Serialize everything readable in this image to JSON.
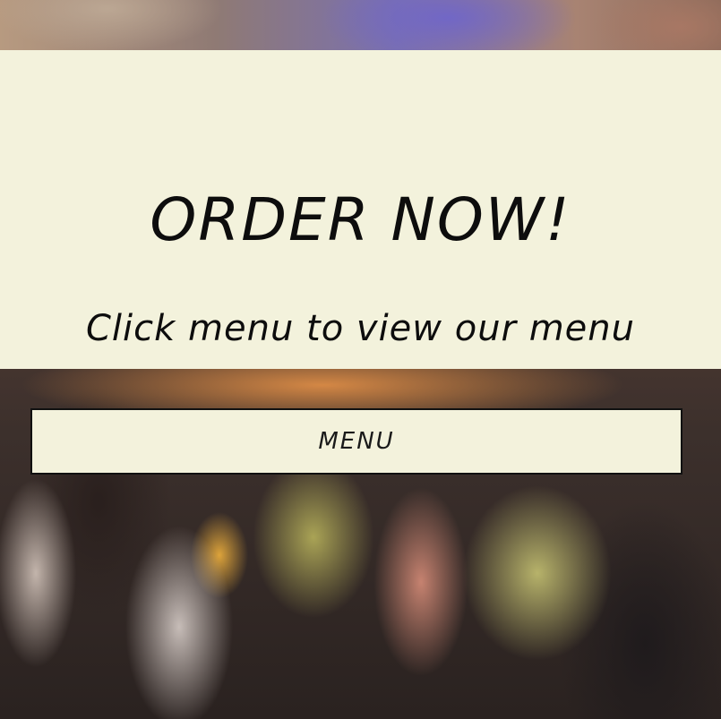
{
  "hero": {
    "title": "ORDER NOW!",
    "subtitle": "Click menu to view our menu"
  },
  "menu_button": {
    "label": "MENU"
  },
  "colors": {
    "panel_background": "#f3f2dc",
    "text": "#0d0d0d",
    "button_border": "#111111"
  }
}
